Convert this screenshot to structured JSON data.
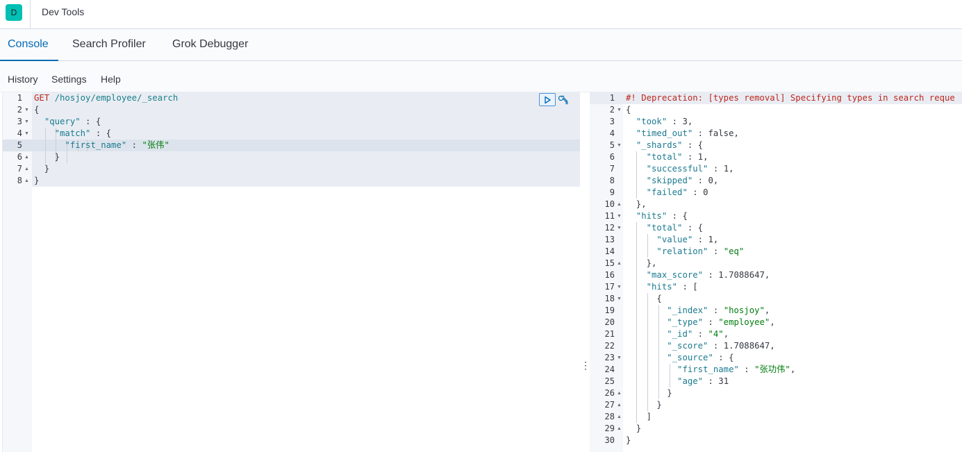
{
  "header": {
    "app_letter": "D",
    "title": "Dev Tools"
  },
  "tabs": [
    {
      "label": "Console",
      "active": true
    },
    {
      "label": "Search Profiler",
      "active": false
    },
    {
      "label": "Grok Debugger",
      "active": false
    }
  ],
  "menu": {
    "history": "History",
    "settings": "Settings",
    "help": "Help"
  },
  "request": {
    "line_numbers": [
      "1",
      "2",
      "3",
      "4",
      "5",
      "6",
      "7",
      "8"
    ],
    "method": "GET",
    "path": "/hosjoy/employee/_search",
    "lines": [
      "{",
      "  \"query\" : {",
      "    \"match\" : {",
      "      \"first_name\" : \"张伟\"",
      "    }",
      "  }",
      "}"
    ]
  },
  "response": {
    "line_numbers": [
      "1",
      "2",
      "3",
      "4",
      "5",
      "6",
      "7",
      "8",
      "9",
      "10",
      "11",
      "12",
      "13",
      "14",
      "15",
      "16",
      "17",
      "18",
      "19",
      "20",
      "21",
      "22",
      "23",
      "24",
      "25",
      "26",
      "27",
      "28",
      "29",
      "30"
    ],
    "deprecation": "#! Deprecation: [types removal] Specifying types in search reque",
    "lines": [
      "{",
      "  \"took\" : 3,",
      "  \"timed_out\" : false,",
      "  \"_shards\" : {",
      "    \"total\" : 1,",
      "    \"successful\" : 1,",
      "    \"skipped\" : 0,",
      "    \"failed\" : 0",
      "  },",
      "  \"hits\" : {",
      "    \"total\" : {",
      "      \"value\" : 1,",
      "      \"relation\" : \"eq\"",
      "    },",
      "    \"max_score\" : 1.7088647,",
      "    \"hits\" : [",
      "      {",
      "        \"_index\" : \"hosjoy\",",
      "        \"_type\" : \"employee\",",
      "        \"_id\" : \"4\",",
      "        \"_score\" : 1.7088647,",
      "        \"_source\" : {",
      "          \"first_name\" : \"张功伟\",",
      "          \"age\" : 31",
      "        }",
      "      }",
      "    ]",
      "  }",
      "}"
    ]
  },
  "icons": {
    "run": "play-icon",
    "settings": "wrench-icon",
    "resize": "vertical-dots-icon"
  },
  "colors": {
    "accent": "#006bb4",
    "badge": "#00bfb3",
    "string": "#017d0e",
    "key": "#1b7a8f",
    "deprecation": "#bd271e"
  }
}
